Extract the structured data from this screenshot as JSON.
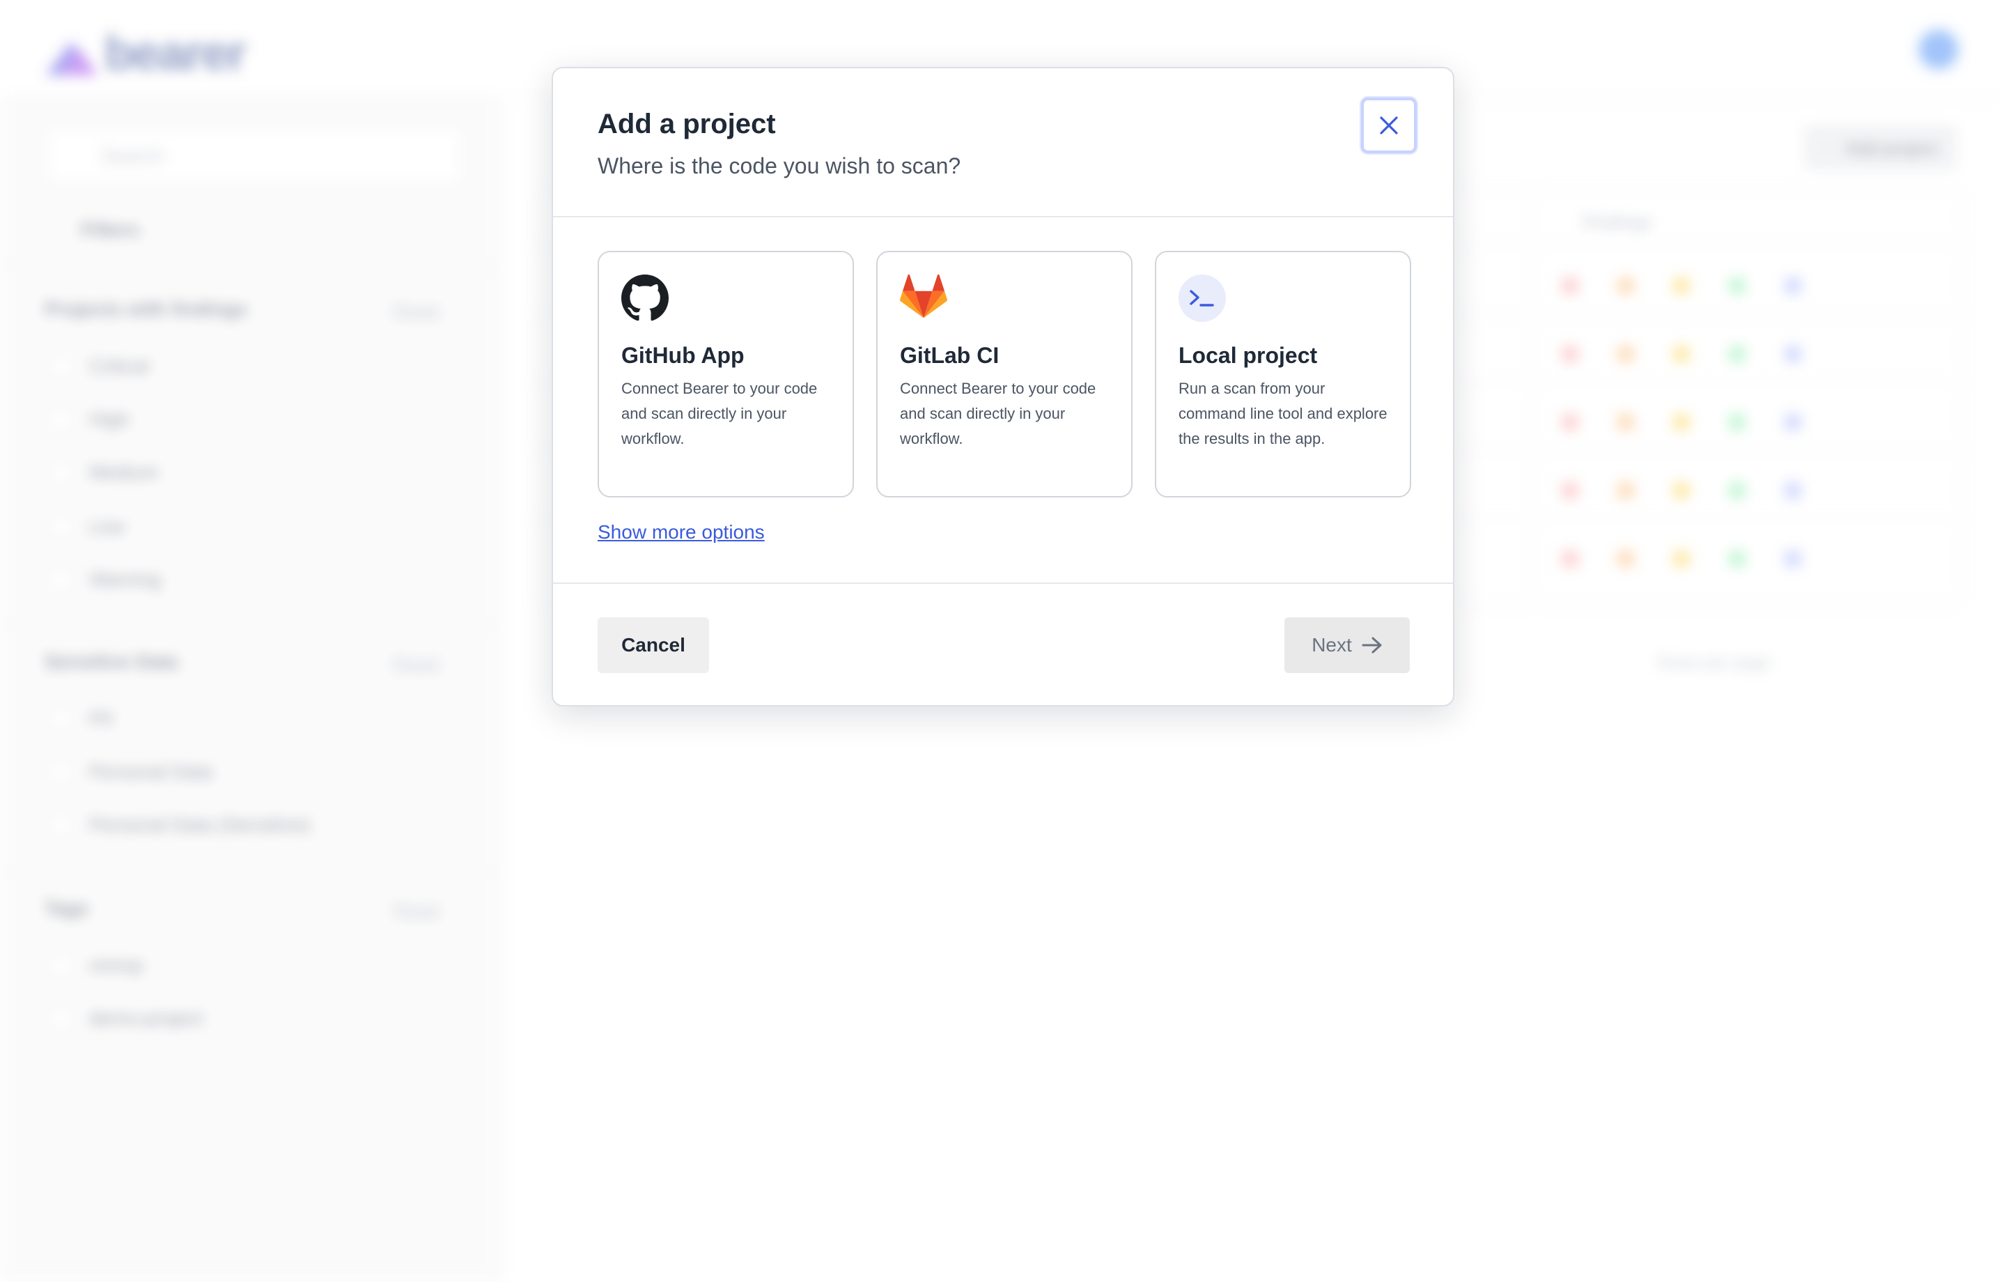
{
  "background": {
    "logo_text": "bearer",
    "search_placeholder": "Search",
    "filters_label": "Filters",
    "sections": [
      {
        "title": "Projects with findings",
        "reset": "Reset",
        "items": [
          "Critical",
          "High",
          "Medium",
          "Low",
          "Warning"
        ]
      },
      {
        "title": "Sensitive Data",
        "reset": "Reset",
        "items": [
          "PII",
          "Personal Data",
          "Personal Data (Sensitive)"
        ]
      },
      {
        "title": "Tags",
        "reset": "Reset",
        "items": [
          "mmnp",
          "demo-project"
        ]
      }
    ],
    "add_project_label": "Add project",
    "findings_column_label": "Findings",
    "rows_per_page_label": "Rows per page"
  },
  "modal": {
    "title": "Add a project",
    "subtitle": "Where is the code you wish to scan?",
    "close_icon": "close-icon",
    "options": [
      {
        "icon": "github-icon",
        "title": "GitHub App",
        "description": "Connect Bearer to your code and scan directly in your workflow."
      },
      {
        "icon": "gitlab-icon",
        "title": "GitLab CI",
        "description": "Connect Bearer to your code and scan directly in your workflow."
      },
      {
        "icon": "terminal-icon",
        "title": "Local project",
        "description": "Run a scan from your command line tool and explore the results in the app."
      }
    ],
    "show_more_label": "Show more options",
    "cancel_label": "Cancel",
    "next_label": "Next",
    "next_icon": "arrow-right-icon"
  },
  "colors": {
    "link": "#3b5bdb",
    "close_icon": "#3b5bdb",
    "gitlab_orange": "#e2432a"
  }
}
